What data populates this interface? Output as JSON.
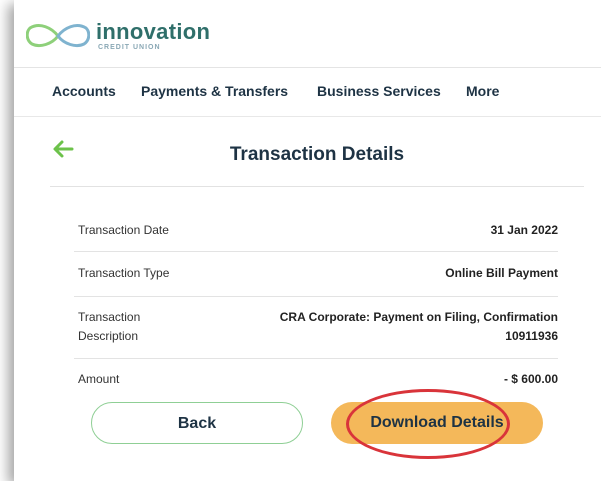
{
  "brand": {
    "name": "innovation",
    "subtitle": "CREDIT UNION",
    "colors": {
      "primary": "#2f6f6a",
      "accent": "#8ed07a",
      "logo_blue": "#7fb3cf"
    }
  },
  "nav": {
    "items": [
      {
        "label": "Accounts"
      },
      {
        "label": "Payments & Transfers"
      },
      {
        "label": "Business Services"
      },
      {
        "label": "More"
      }
    ]
  },
  "page": {
    "title": "Transaction Details",
    "back_icon": "arrow-left-icon"
  },
  "details": [
    {
      "label": "Transaction Date",
      "value": "31 Jan 2022"
    },
    {
      "label": "Transaction Type",
      "value": "Online Bill Payment"
    },
    {
      "label_line1": "Transaction",
      "label_line2": "Description",
      "value_line1": "CRA Corporate: Payment on Filing, Confirmation",
      "value_line2": "10911936"
    },
    {
      "label": "Amount",
      "value": "- $ 600.00"
    }
  ],
  "buttons": {
    "back_label": "Back",
    "download_label": "Download Details"
  },
  "annotation": {
    "ring_color": "#d9343a",
    "target": "download-details-button"
  }
}
